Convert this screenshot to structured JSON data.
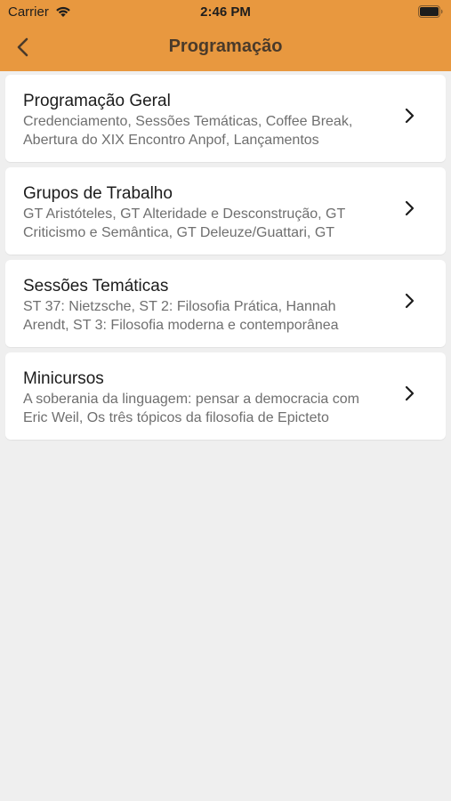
{
  "status_bar": {
    "carrier": "Carrier",
    "time": "2:46 PM"
  },
  "nav": {
    "title": "Programação",
    "back_icon": "chevron-left-icon"
  },
  "colors": {
    "header": "#e8983f",
    "background": "#efefef",
    "card": "#ffffff"
  },
  "items": [
    {
      "title": "Programação Geral",
      "subtitle": "Credenciamento, Sessões Temáticas, Coffee Break, Abertura do XIX Encontro Anpof, Lançamentos"
    },
    {
      "title": "Grupos de Trabalho",
      "subtitle": "GT Aristóteles, GT Alteridade e Desconstrução, GT Criticismo e Semântica, GT Deleuze/Guattari, GT"
    },
    {
      "title": "Sessões Temáticas",
      "subtitle": "ST 37: Nietzsche, ST 2: Filosofia Prática, Hannah Arendt, ST 3:  Filosofia moderna e contemporânea"
    },
    {
      "title": "Minicursos",
      "subtitle": "A soberania da linguagem: pensar a democracia com Eric Weil, Os três tópicos da filosofia de Epicteto"
    }
  ]
}
